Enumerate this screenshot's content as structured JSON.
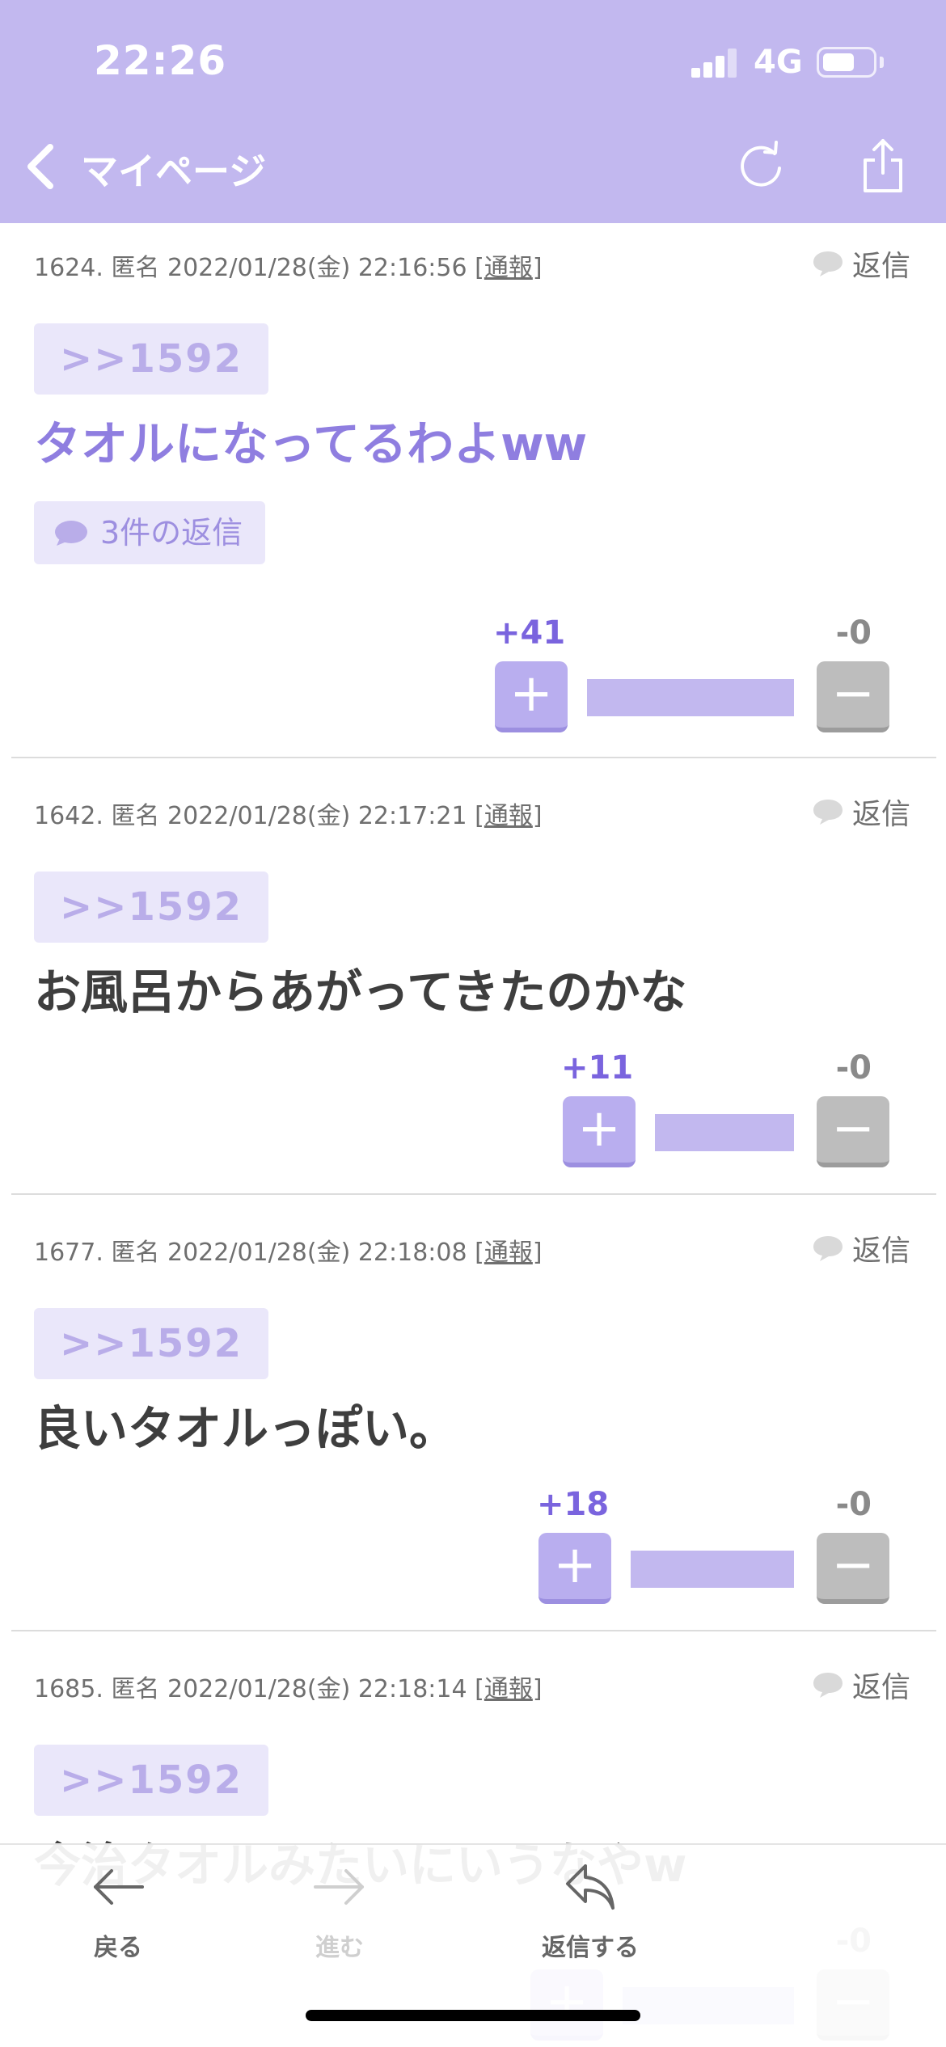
{
  "status_bar": {
    "time": "22:26",
    "network": "4G"
  },
  "nav": {
    "title": "マイページ"
  },
  "colors": {
    "accent": "#c2b8ef",
    "vote_up": "#7a64de",
    "vote_down": "#bdbdbd"
  },
  "posts": [
    {
      "number": "1624.",
      "author": "匿名",
      "datetime": "2022/01/28(金) 22:16:56",
      "report_open": "[",
      "report_label": "通報",
      "report_close": "]",
      "reply_label": "返信",
      "anchor": ">>1592",
      "text": "タオルになってるわよww",
      "replies_label": "3件の返信",
      "plus": "+41",
      "minus": "-0",
      "up_fraction": 1.0
    },
    {
      "number": "1642.",
      "author": "匿名",
      "datetime": "2022/01/28(金) 22:17:21",
      "report_open": "[",
      "report_label": "通報",
      "report_close": "]",
      "reply_label": "返信",
      "anchor": ">>1592",
      "text": "お風呂からあがってきたのかな",
      "plus": "+11",
      "minus": "-0",
      "up_fraction": 1.0
    },
    {
      "number": "1677.",
      "author": "匿名",
      "datetime": "2022/01/28(金) 22:18:08",
      "report_open": "[",
      "report_label": "通報",
      "report_close": "]",
      "reply_label": "返信",
      "anchor": ">>1592",
      "text": "良いタオルっぽい。",
      "plus": "+18",
      "minus": "-0",
      "up_fraction": 1.0
    },
    {
      "number": "1685.",
      "author": "匿名",
      "datetime": "2022/01/28(金) 22:18:14",
      "report_open": "[",
      "report_label": "通報",
      "report_close": "]",
      "reply_label": "返信",
      "anchor": ">>1592",
      "text": "今治タオルみたいにいうなやw",
      "minus": "-0"
    }
  ],
  "toolbar": {
    "back_label": "戻る",
    "forward_label": "進む",
    "reply_label": "返信する"
  }
}
